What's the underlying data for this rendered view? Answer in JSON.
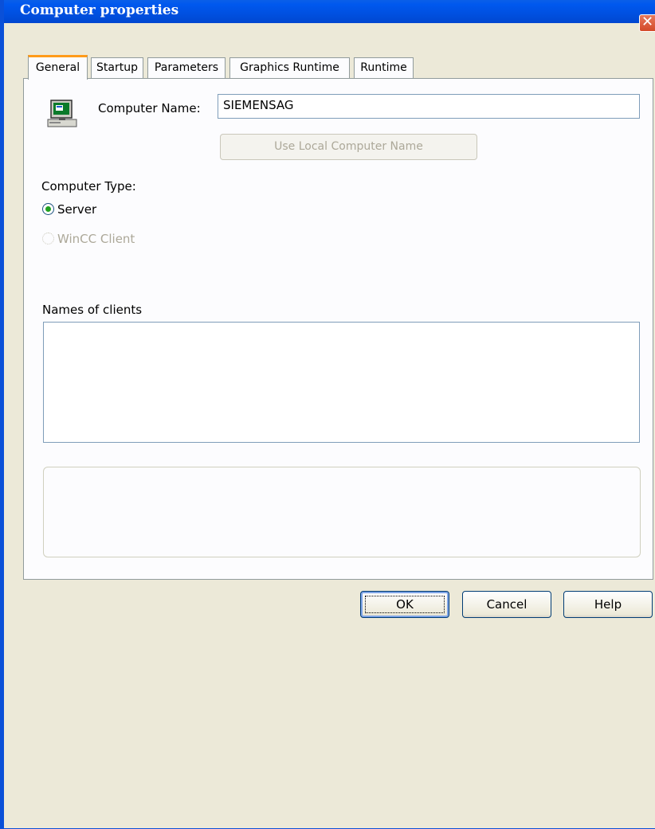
{
  "window": {
    "title": "Computer properties",
    "close_glyph": "✕"
  },
  "tabs": [
    {
      "label": "General",
      "active": true
    },
    {
      "label": "Startup",
      "active": false
    },
    {
      "label": "Parameters",
      "active": false
    },
    {
      "label": "Graphics Runtime",
      "active": false
    },
    {
      "label": "Runtime",
      "active": false
    }
  ],
  "general": {
    "icon": "computer-icon",
    "computer_name_label": "Computer Name:",
    "computer_name_value": "SIEMENSAG",
    "use_local_button": "Use Local Computer Name",
    "computer_type_label": "Computer Type:",
    "radio_server": "Server",
    "radio_server_selected": true,
    "radio_client": "WinCC Client",
    "radio_client_enabled": false,
    "clients_label": "Names of clients",
    "clients_list": []
  },
  "buttons": {
    "ok": "OK",
    "cancel": "Cancel",
    "help": "Help"
  },
  "colors": {
    "titlebar": "#0054e3",
    "active_tab_accent": "#ff9b1a",
    "dialog_bg": "#ece9d8",
    "radio_dot": "#21a121"
  }
}
